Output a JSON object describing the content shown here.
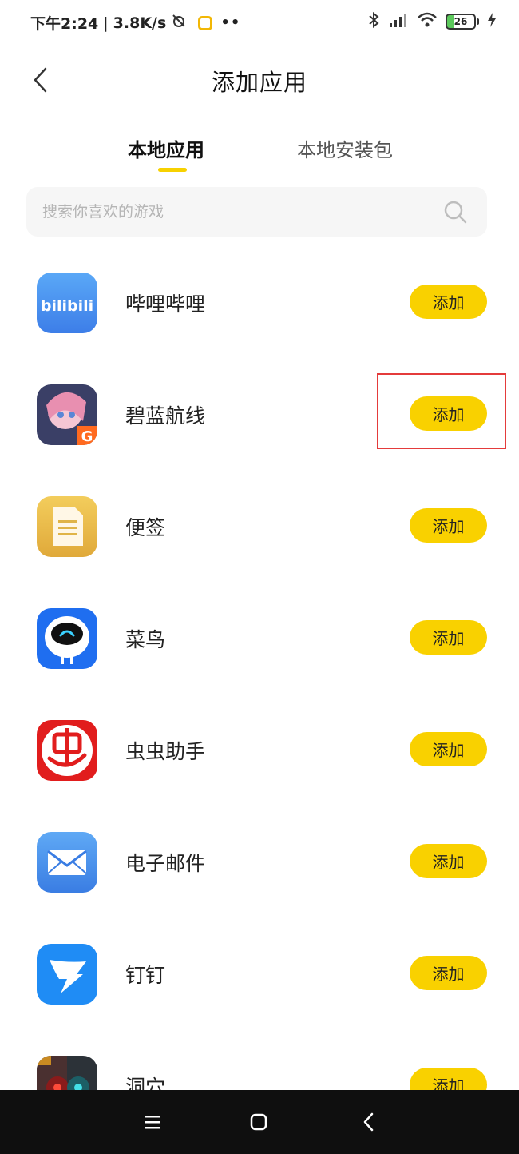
{
  "status_bar": {
    "time": "下午2:24",
    "separator": "|",
    "net_speed": "3.8K/s",
    "battery_level": "26"
  },
  "header": {
    "title": "添加应用"
  },
  "tabs": [
    {
      "label": "本地应用",
      "active": true
    },
    {
      "label": "本地安装包",
      "active": false
    }
  ],
  "search": {
    "placeholder": "搜索你喜欢的游戏"
  },
  "apps": [
    {
      "name": "哔哩哔哩",
      "icon": "bilibili-icon",
      "button": "添加"
    },
    {
      "name": "碧蓝航线",
      "icon": "azur-lane-icon",
      "button": "添加"
    },
    {
      "name": "便签",
      "icon": "notes-icon",
      "button": "添加"
    },
    {
      "name": "菜鸟",
      "icon": "cainiao-icon",
      "button": "添加"
    },
    {
      "name": "虫虫助手",
      "icon": "chongchong-icon",
      "button": "添加"
    },
    {
      "name": "电子邮件",
      "icon": "email-icon",
      "button": "添加"
    },
    {
      "name": "钉钉",
      "icon": "dingtalk-icon",
      "button": "添加"
    },
    {
      "name": "洞穴",
      "icon": "cave-game-icon",
      "button": "添加"
    }
  ],
  "colors": {
    "accent": "#f9d100",
    "highlight": "#e43b3b"
  }
}
